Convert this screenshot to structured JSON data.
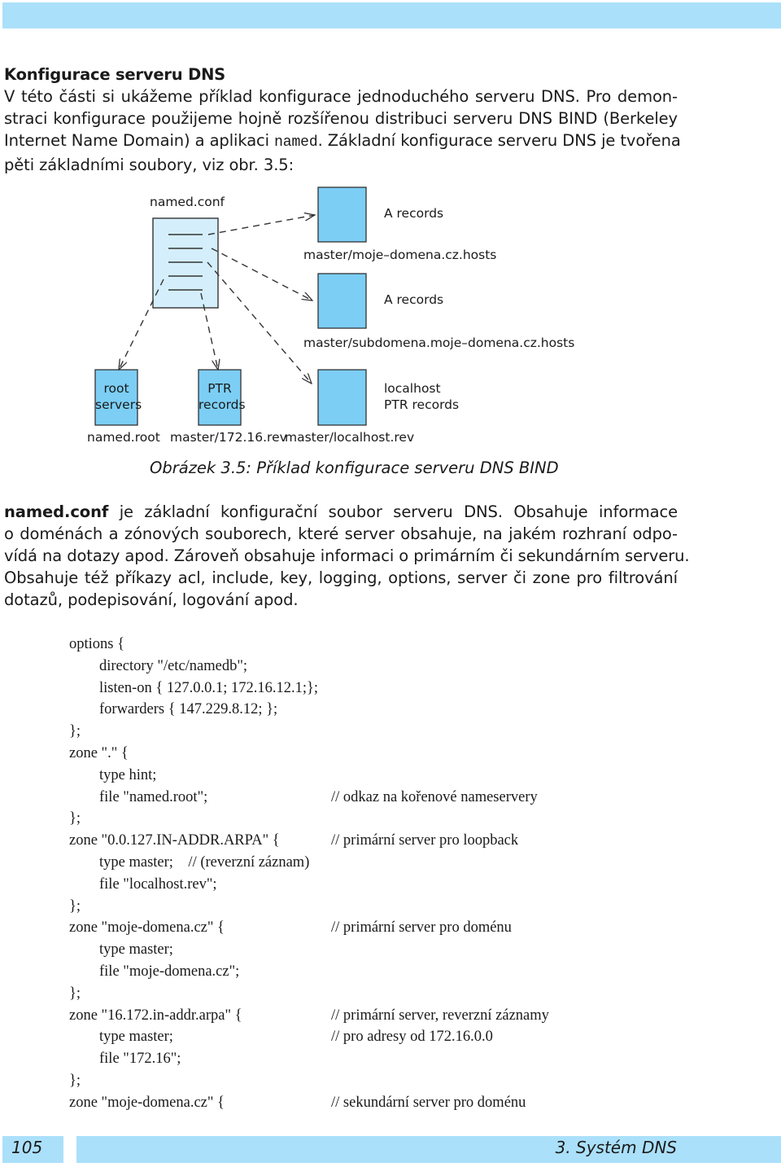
{
  "header": {
    "band_color": "#abe0fa"
  },
  "section": {
    "title": "Konfigurace serveru DNS",
    "intro_lines": [
      "V této části si ukážeme příklad konfigurace jednoduchého serveru DNS. Pro demon-",
      "straci konfigurace použijeme hojně rozšířenou distribuci serveru DNS BIND (Berkeley",
      "Internet Name Domain) a aplikaci ",
      "pěti základními soubory, viz obr. 3.5:"
    ],
    "intro_line3_code": "named",
    "intro_line3_rest": ". Základní konfigurace serveru DNS je tvořena"
  },
  "figure": {
    "main_file": {
      "label": "named.conf",
      "fill": "#d4eefb"
    },
    "files": [
      {
        "label": "master/moje–domena.cz.hosts",
        "note": "A records",
        "box_text": []
      },
      {
        "label": "master/subdomena.moje–domena.cz.hosts",
        "note": "A records",
        "box_text": []
      },
      {
        "label": "named.root",
        "note": "",
        "box_text": [
          "root",
          "servers"
        ]
      },
      {
        "label": "master/172.16.rev",
        "note": "",
        "box_text": [
          "PTR",
          "records"
        ]
      },
      {
        "label": "master/localhost.rev",
        "note_lines": [
          "localhost",
          "PTR records"
        ],
        "box_text": []
      }
    ],
    "box_fill": "#7ccef5",
    "caption": "Obrázek 3.5: Příklad konfigurace serveru DNS BIND"
  },
  "paragraph2": {
    "lead_bold": "named.conf",
    "lines": [
      " je základní konfigurační soubor serveru DNS. Obsahuje informace",
      "o doménách a zónových souborech, které server obsahuje, na jakém rozhraní odpo-",
      "vídá na dotazy apod. Zároveň obsahuje informaci o primárním či sekundárním serveru.",
      "Obsahuje též příkazy acl, include, key, logging, options, server či zone pro filtrování",
      "dotazů, podepisování, logování apod."
    ]
  },
  "code": {
    "lines": [
      {
        "text": "options {",
        "comment": ""
      },
      {
        "text": "        directory \"/etc/namedb\";",
        "comment": ""
      },
      {
        "text": "        listen-on { 127.0.0.1; 172.16.12.1;};",
        "comment": ""
      },
      {
        "text": "        forwarders { 147.229.8.12; };",
        "comment": ""
      },
      {
        "text": "};",
        "comment": ""
      },
      {
        "text": "zone \".\" {",
        "comment": ""
      },
      {
        "text": "        type hint;",
        "comment": ""
      },
      {
        "text": "        file \"named.root\";",
        "comment": "// odkaz na kořenové nameservery"
      },
      {
        "text": "};",
        "comment": ""
      },
      {
        "text": "zone \"0.0.127.IN-ADDR.ARPA\" {",
        "comment": "// primární server pro loopback"
      },
      {
        "text": "        type master;    // (reverzní záznam)",
        "comment": ""
      },
      {
        "text": "        file \"localhost.rev\";",
        "comment": ""
      },
      {
        "text": "};",
        "comment": ""
      },
      {
        "text": "zone \"moje-domena.cz\" {",
        "comment": "// primární server pro doménu"
      },
      {
        "text": "        type master;",
        "comment": ""
      },
      {
        "text": "        file \"moje-domena.cz\";",
        "comment": ""
      },
      {
        "text": "};",
        "comment": ""
      },
      {
        "text": "zone \"16.172.in-addr.arpa\" {",
        "comment": "// primární server, reverzní záznamy"
      },
      {
        "text": "        type master;",
        "comment": "// pro adresy od 172.16.0.0"
      },
      {
        "text": "        file \"172.16\";",
        "comment": ""
      },
      {
        "text": "};",
        "comment": ""
      },
      {
        "text": "zone \"moje-domena.cz\" {",
        "comment": "// sekundární server pro doménu"
      }
    ]
  },
  "footer": {
    "page_number": "105",
    "chapter": "3. Systém DNS"
  }
}
